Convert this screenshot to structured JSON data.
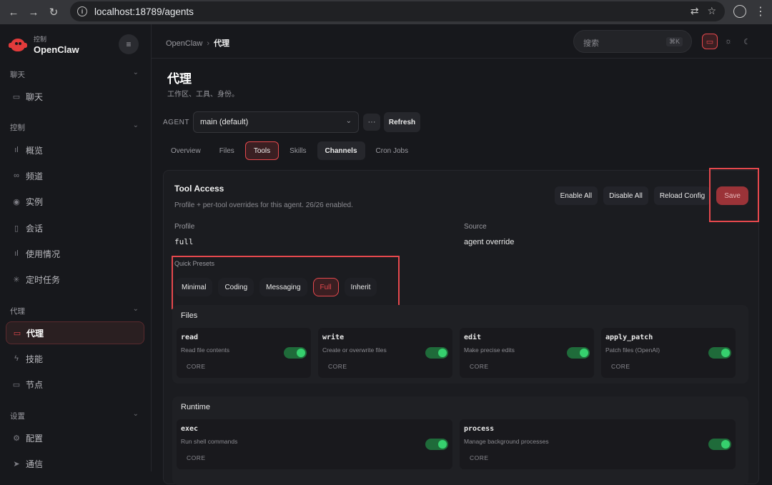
{
  "browser": {
    "url": "localhost:18789/agents"
  },
  "sidebar": {
    "brand_sub": "控制",
    "brand_name": "OpenClaw",
    "sections": [
      {
        "label": "聊天",
        "items": [
          {
            "label": "聊天",
            "icon": "chat-icon"
          }
        ]
      },
      {
        "label": "控制",
        "items": [
          {
            "label": "概览",
            "icon": "bar-chart-icon"
          },
          {
            "label": "频道",
            "icon": "link-icon"
          },
          {
            "label": "实例",
            "icon": "radio-icon"
          },
          {
            "label": "会话",
            "icon": "document-icon"
          },
          {
            "label": "使用情况",
            "icon": "bar-chart-icon"
          },
          {
            "label": "定时任务",
            "icon": "loader-icon"
          }
        ]
      },
      {
        "label": "代理",
        "items": [
          {
            "label": "代理",
            "icon": "folder-icon",
            "active": true
          },
          {
            "label": "技能",
            "icon": "zap-icon"
          },
          {
            "label": "节点",
            "icon": "monitor-icon"
          }
        ]
      },
      {
        "label": "设置",
        "items": [
          {
            "label": "配置",
            "icon": "gear-icon"
          },
          {
            "label": "通信",
            "icon": "send-icon"
          }
        ]
      }
    ]
  },
  "header": {
    "breadcrumb_root": "OpenClaw",
    "breadcrumb_sep": "›",
    "breadcrumb_current": "代理",
    "search_placeholder": "搜索",
    "search_shortcut": "⌘K",
    "theme_options": [
      "monitor-icon",
      "sun-icon",
      "moon-icon"
    ],
    "theme_selected": "monitor-icon"
  },
  "page": {
    "title": "代理",
    "subtitle": "工作区、工具、身份。",
    "agent_label": "AGENT",
    "agent_selected": "main (default)",
    "more_label": "···",
    "refresh_label": "Refresh",
    "tabs": [
      "Overview",
      "Files",
      "Tools",
      "Skills",
      "Channels",
      "Cron Jobs"
    ],
    "active_tab": "Tools"
  },
  "tool_access": {
    "title": "Tool Access",
    "subtitle": "Profile + per-tool overrides for this agent. 26/26 enabled.",
    "actions": {
      "enable_all": "Enable All",
      "disable_all": "Disable All",
      "reload": "Reload Config",
      "save": "Save"
    },
    "profile_label": "Profile",
    "profile_value": "full",
    "source_label": "Source",
    "source_value": "agent override",
    "presets_label": "Quick Presets",
    "presets": [
      "Minimal",
      "Coding",
      "Messaging",
      "Full",
      "Inherit"
    ],
    "preset_selected": "Full",
    "groups": [
      {
        "title": "Files",
        "tools": [
          {
            "name": "read",
            "desc": "Read file contents",
            "tag": "CORE",
            "enabled": true
          },
          {
            "name": "write",
            "desc": "Create or overwrite files",
            "tag": "CORE",
            "enabled": true
          },
          {
            "name": "edit",
            "desc": "Make precise edits",
            "tag": "CORE",
            "enabled": true
          },
          {
            "name": "apply_patch",
            "desc": "Patch files (OpenAI)",
            "tag": "CORE",
            "enabled": true
          }
        ]
      },
      {
        "title": "Runtime",
        "tools": [
          {
            "name": "exec",
            "desc": "Run shell commands",
            "tag": "CORE",
            "enabled": true
          },
          {
            "name": "process",
            "desc": "Manage background processes",
            "tag": "CORE",
            "enabled": true
          }
        ]
      }
    ]
  },
  "colors": {
    "accent": "#e5484d",
    "toggle_on": "#36d06e",
    "background": "#17181c"
  }
}
